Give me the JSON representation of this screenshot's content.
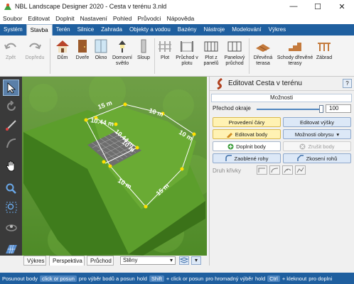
{
  "window": {
    "title": "NBL Landscape Designer 2020 - Cesta v terénu 3.nld",
    "minimize": "—",
    "maximize": "☐",
    "close": "✕"
  },
  "menu": [
    "Soubor",
    "Editovat",
    "Doplnit",
    "Nastavení",
    "Pohled",
    "Průvodci",
    "Nápověda"
  ],
  "ribbon_tabs": [
    "Systém",
    "Stavba",
    "Terén",
    "Silnice",
    "Zahrada",
    "Objekty a vodou",
    "Bazény",
    "Nástroje",
    "Modelování",
    "Výkres"
  ],
  "active_ribbon_tab": "Stavba",
  "ribbon_buttons": {
    "back": "Zpět",
    "forward": "Dopředu",
    "house": "Dům",
    "doors": "Dveře",
    "window": "Okno",
    "home_light_1": "Domovní",
    "home_light_2": "světlo",
    "pillar": "Sloup",
    "fence": "Plot",
    "passage_1": "Průchod v",
    "passage_2": "plotu",
    "panel_fence_1": "Plot z",
    "panel_fence_2": "panelů",
    "panel_pass_1": "Panelový",
    "panel_pass_2": "průchod",
    "wood_terrace_1": "Dřevěná",
    "wood_terrace_2": "terasa",
    "wood_stairs_1": "Schody dřevěné",
    "wood_stairs_2": "terasy",
    "more": "Zábrad"
  },
  "dimensions": [
    "15 m",
    "10 m",
    "10.44 m",
    "10.44 m",
    "10 m",
    "10 m",
    "10 m",
    "15 m"
  ],
  "viewport_tabs": [
    "Výkres",
    "Perspektiva",
    "Průchod"
  ],
  "active_viewport_tab": "Perspektiva",
  "viewport_select": "Stěny",
  "panel": {
    "title": "Editovat Cesta v terénu",
    "help": "?",
    "section": "Možnosti",
    "slider_label": "Přechod okraje",
    "slider_value": "100",
    "slider_fraction": 1.0,
    "btn_lines": "Provedení čáry",
    "btn_heights": "Editovat výšky",
    "btn_edit_points": "Editovat body",
    "btn_outline": "Možnosti obrysu",
    "btn_add_points": "Doplnit body",
    "btn_remove_points": "Zrušit body",
    "btn_round_corners": "Zaoblené rohy",
    "btn_sharp_corners": "Zkosení rohů",
    "curve_label": "Druh křivky"
  },
  "status": {
    "s1": "Posunout body",
    "s2": "click or posun",
    "s3": "pro výběr bodů a posun",
    "s4": "hold",
    "shift": "Shift",
    "s5": "+ click or posun",
    "s6": "pro hromadný výběr",
    "s7": "hold",
    "ctrl": "Ctrl",
    "s8": "+ kleknout",
    "s9": "pro doplni"
  },
  "colors": {
    "accent": "#1f5f9f",
    "grass": "#5fa02f",
    "outline": "#ffffff",
    "points": "#ffe000"
  }
}
